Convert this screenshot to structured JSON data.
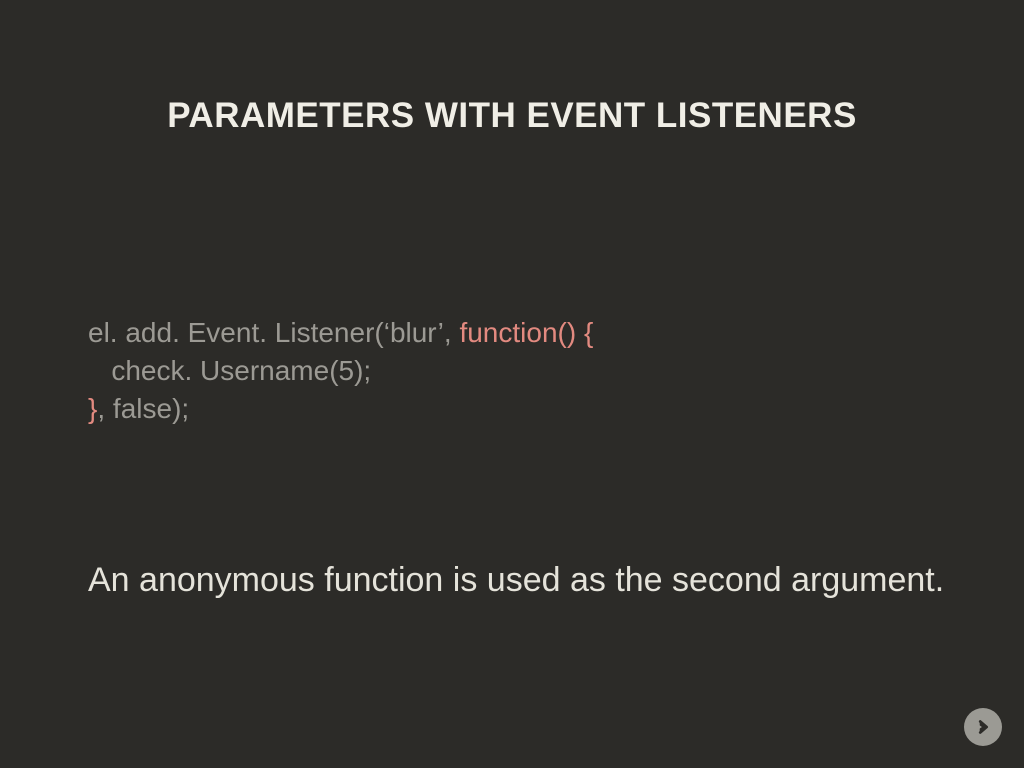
{
  "title": "PARAMETERS WITH EVENT LISTENERS",
  "code": {
    "line1_prefix": "el. add. Event. Listener(‘blur’, ",
    "line1_hl": "function() {",
    "line2": "   check. Username(5);",
    "line3_hl": "}",
    "line3_suffix": ", false);"
  },
  "caption": "An anonymous function is used as the second argument.",
  "nav": {
    "next_label": "next"
  }
}
